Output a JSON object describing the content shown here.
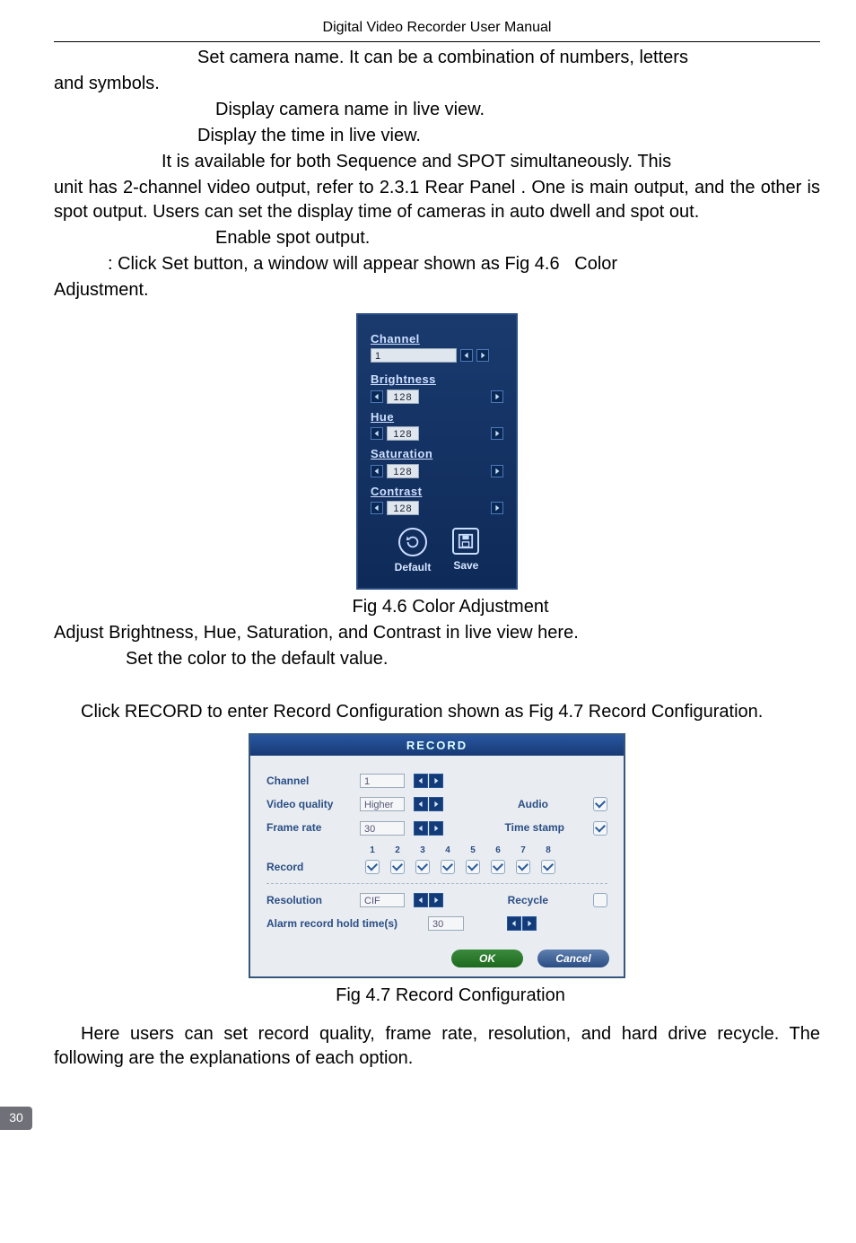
{
  "header": "Digital Video Recorder User Manual",
  "body": {
    "p1a": "Set camera name. It can be a combination of numbers, letters",
    "p1b": "and symbols.",
    "p2": "Display camera name in live view.",
    "p3": "Display the time in live view.",
    "p4a": "It is available for both Sequence and SPOT simultaneously. This",
    "p4b": "unit has 2-channel video output, refer to 2.3.1 Rear Panel . One is main output, and the other is spot output. Users can set the display time of cameras in auto dwell and spot out.",
    "p5": "Enable spot output.",
    "p6a": ": Click Set button, a window will appear shown as Fig 4.6",
    "p6b": "Color",
    "p6c": "Adjustment.",
    "cap1": "Fig 4.6    Color Adjustment",
    "p7": "Adjust Brightness, Hue, Saturation, and Contrast in live view here.",
    "p8": "Set the color to the default value.",
    "p9": "Click RECORD to enter Record Configuration shown as Fig 4.7    Record Configuration.",
    "cap2": "Fig 4.7    Record Configuration",
    "p10": "Here users can set record quality, frame rate, resolution, and hard drive recycle. The following are the explanations of each option."
  },
  "color_panel": {
    "channel_label": "Channel",
    "channel_value": "1",
    "brightness_label": "Brightness",
    "brightness_value": "128",
    "hue_label": "Hue",
    "hue_value": "128",
    "saturation_label": "Saturation",
    "saturation_value": "128",
    "contrast_label": "Contrast",
    "contrast_value": "128",
    "default_label": "Default",
    "save_label": "Save"
  },
  "record_panel": {
    "title": "RECORD",
    "channel_label": "Channel",
    "channel_value": "1",
    "video_quality_label": "Video quality",
    "video_quality_value": "Higher",
    "audio_label": "Audio",
    "frame_rate_label": "Frame rate",
    "frame_rate_value": "30",
    "time_stamp_label": "Time stamp",
    "record_label": "Record",
    "nums": [
      "1",
      "2",
      "3",
      "4",
      "5",
      "6",
      "7",
      "8"
    ],
    "resolution_label": "Resolution",
    "resolution_value": "CIF",
    "recycle_label": "Recycle",
    "hold_label": "Alarm record hold time(s)",
    "hold_value": "30",
    "ok": "OK",
    "cancel": "Cancel"
  },
  "page_number": "30"
}
